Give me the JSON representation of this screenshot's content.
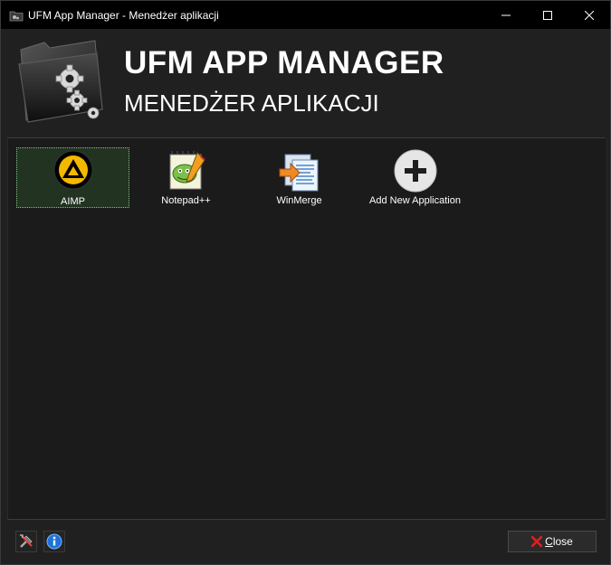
{
  "window": {
    "title": "UFM App Manager - Menedżer aplikacji",
    "icon": "folder-gear-icon"
  },
  "header": {
    "title": "UFM APP MANAGER",
    "subtitle": "MENEDŻER APLIKACJI",
    "icon": "folder-gears-icon"
  },
  "apps": [
    {
      "label": "AIMP",
      "icon": "aimp-icon",
      "selected": true
    },
    {
      "label": "Notepad++",
      "icon": "notepad-plus-plus-icon",
      "selected": false
    },
    {
      "label": "WinMerge",
      "icon": "winmerge-icon",
      "selected": false
    },
    {
      "label": "Add New Application",
      "icon": "add-circle-icon",
      "selected": false
    }
  ],
  "footer": {
    "tools_icon": "tools-icon",
    "info_icon": "info-icon",
    "close_mnemonic": "C",
    "close_rest": "lose"
  },
  "colors": {
    "background": "#202020",
    "panel": "#1b1b1b",
    "titlebar": "#000000",
    "selection": "#233322",
    "aimp_accent": "#f5b800",
    "close_x": "#e02020",
    "info_blue": "#1a73d9"
  }
}
